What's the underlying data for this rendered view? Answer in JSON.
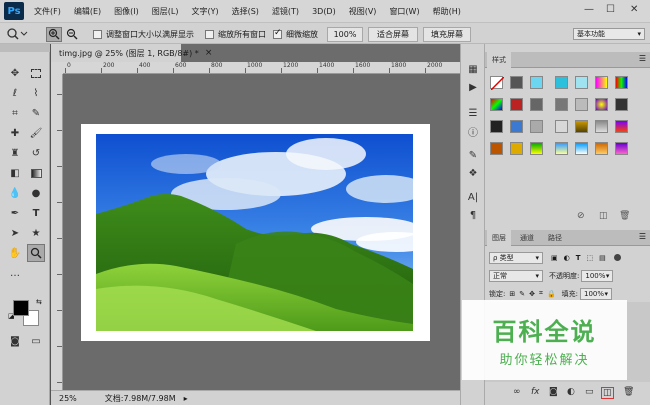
{
  "app": {
    "logo": "Ps"
  },
  "menu": [
    "文件(F)",
    "编辑(E)",
    "图像(I)",
    "图层(L)",
    "文字(Y)",
    "选择(S)",
    "滤镜(T)",
    "3D(D)",
    "视图(V)",
    "窗口(W)",
    "帮助(H)"
  ],
  "window_controls": {
    "minimize": "—",
    "maximize": "☐",
    "close": "✕"
  },
  "options": {
    "resize_windows": "调整窗口大小以满屏显示",
    "zoom_all": "缩放所有窗口",
    "scrubby_zoom": "细微缩放",
    "zoom_value": "100%",
    "fit_screen": "适合屏幕",
    "fill_screen": "填充屏幕",
    "workspace": "基本功能"
  },
  "document": {
    "tab_title": "timg.jpg @ 25% (图层 1, RGB/8#) *",
    "tab_close": "×",
    "ruler_labels": [
      "0",
      "200",
      "400",
      "600",
      "800",
      "1000",
      "1200",
      "1400",
      "1600",
      "1800",
      "2000"
    ]
  },
  "status": {
    "zoom": "25%",
    "doc_info": "文档:7.98M/7.98M"
  },
  "styles_panel": {
    "tab": "样式"
  },
  "layers_panel": {
    "tabs": [
      "图层",
      "通道",
      "路径"
    ],
    "filter_kind": "ρ 类型",
    "blend_mode": "正常",
    "opacity_label": "不透明度:",
    "opacity_value": "100%",
    "lock_label": "锁定:",
    "fill_label": "填充:",
    "fill_value": "100%"
  },
  "watermark": {
    "title": "百科全说",
    "subtitle": "助你轻松解决"
  },
  "colors": {
    "accent_green": "#4caf50",
    "ps_blue": "#31a8ff",
    "panel_bg": "#d2d2d2"
  }
}
